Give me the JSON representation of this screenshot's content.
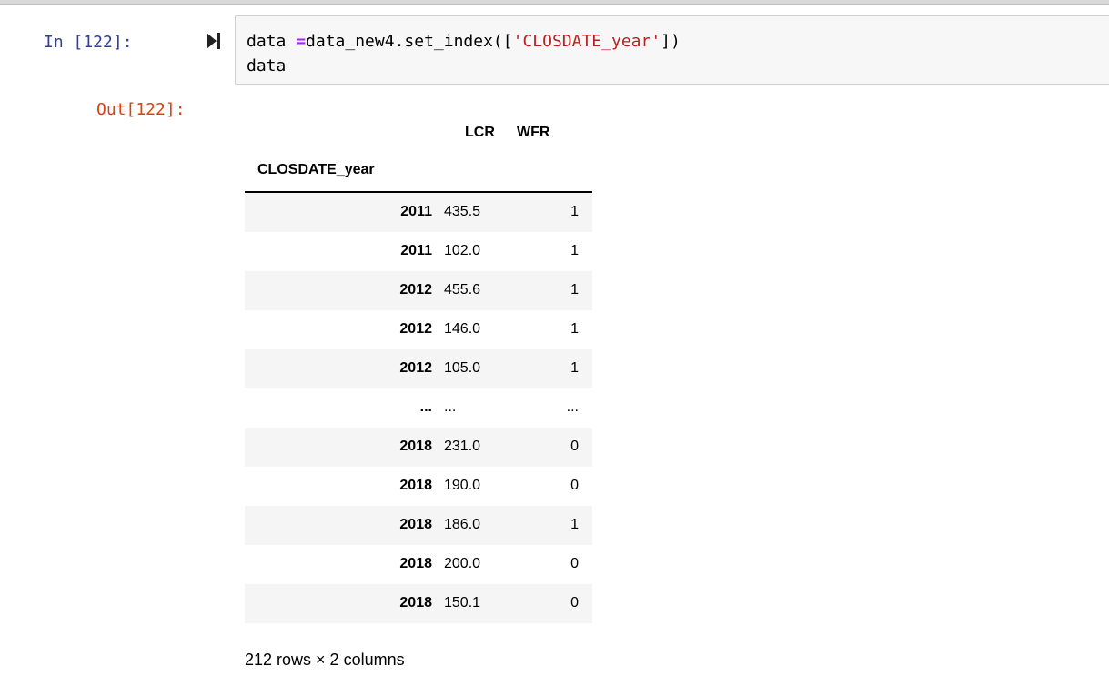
{
  "cell": {
    "in_prompt": "In [122]:",
    "out_prompt": "Out[122]:",
    "run_icon": "run-cell-icon",
    "code": {
      "line1": {
        "pre": "data ",
        "op": "=",
        "mid": "data_new4.set_index([",
        "str": "'CLOSDATE_year'",
        "post": "])"
      },
      "line2": "data"
    }
  },
  "dataframe": {
    "columns": [
      "LCR",
      "WFR"
    ],
    "index_name": "CLOSDATE_year",
    "rows": [
      {
        "idx": "2011",
        "lcr": "435.5",
        "wfr": "1"
      },
      {
        "idx": "2011",
        "lcr": "102.0",
        "wfr": "1"
      },
      {
        "idx": "2012",
        "lcr": "455.6",
        "wfr": "1"
      },
      {
        "idx": "2012",
        "lcr": "146.0",
        "wfr": "1"
      },
      {
        "idx": "2012",
        "lcr": "105.0",
        "wfr": "1"
      },
      {
        "idx": "...",
        "lcr": "...",
        "wfr": "..."
      },
      {
        "idx": "2018",
        "lcr": "231.0",
        "wfr": "0"
      },
      {
        "idx": "2018",
        "lcr": "190.0",
        "wfr": "0"
      },
      {
        "idx": "2018",
        "lcr": "186.0",
        "wfr": "1"
      },
      {
        "idx": "2018",
        "lcr": "200.0",
        "wfr": "0"
      },
      {
        "idx": "2018",
        "lcr": "150.1",
        "wfr": "0"
      }
    ],
    "shape_text": "212 rows × 2 columns"
  },
  "colors": {
    "in_prompt": "#303f9f",
    "out_prompt": "#d84315",
    "code_bg": "#f7f7f7",
    "keyword_op": "#aa22ff",
    "string": "#ba2121"
  }
}
